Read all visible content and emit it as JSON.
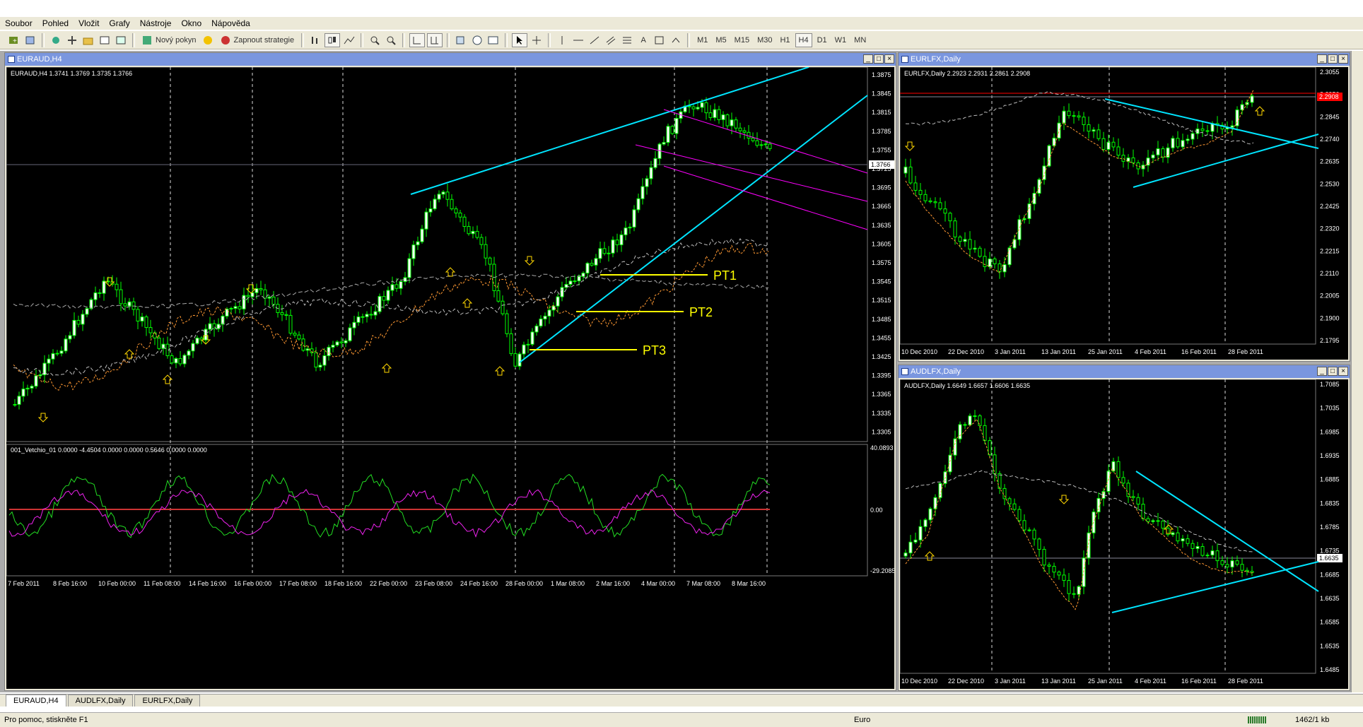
{
  "menu": [
    "Soubor",
    "Pohled",
    "Vložit",
    "Grafy",
    "Nástroje",
    "Okno",
    "Nápověda"
  ],
  "toolbar": {
    "new_order": "Nový pokyn",
    "start_strategy": "Zapnout strategie",
    "text_tool": "A",
    "timeframes": [
      "M1",
      "M5",
      "M15",
      "M30",
      "H1",
      "H4",
      "D1",
      "W1",
      "MN"
    ],
    "active_timeframe": "H4"
  },
  "windows": {
    "euraud": {
      "title": "EURAUD,H4",
      "info": "EURAUD,H4  1.3741 1.3769 1.3735 1.3766",
      "price_labels": [
        "1.3875",
        "1.3845",
        "1.3815",
        "1.3785",
        "1.3755",
        "1.3725",
        "1.3695",
        "1.3665",
        "1.3635",
        "1.3605",
        "1.3575",
        "1.3545",
        "1.3515",
        "1.3485",
        "1.3455",
        "1.3425",
        "1.3395",
        "1.3365",
        "1.3335",
        "1.3305"
      ],
      "current_price": "1.3766",
      "indicator_info": "001_Vetchio_01 0.0000 -4.4504 0.0000 0.0000 0.5646 0.0000 0.0000",
      "indicator_labels": [
        "40.0893",
        "0.00",
        "-29.2085"
      ],
      "date_labels": [
        "7 Feb 2011",
        "8 Feb 16:00",
        "10 Feb 00:00",
        "11 Feb 08:00",
        "14 Feb 16:00",
        "16 Feb 00:00",
        "17 Feb 08:00",
        "18 Feb 16:00",
        "22 Feb 00:00",
        "23 Feb 08:00",
        "24 Feb 16:00",
        "28 Feb 00:00",
        "1 Mar 08:00",
        "2 Mar 16:00",
        "4 Mar 00:00",
        "7 Mar 08:00",
        "8 Mar 16:00"
      ],
      "targets": [
        "PT1",
        "PT2",
        "PT3"
      ]
    },
    "eurlfx": {
      "title": "EURLFX,Daily",
      "info": "EURLFX,Daily  2.2923 2.2931 2.2861 2.2908",
      "price_labels": [
        "2.3055",
        "2.2950",
        "2.2845",
        "2.2740",
        "2.2635",
        "2.2530",
        "2.2425",
        "2.2320",
        "2.2215",
        "2.2110",
        "2.2005",
        "2.1900",
        "2.1795"
      ],
      "current_price": "2.2908",
      "date_labels": [
        "10 Dec 2010",
        "22 Dec 2010",
        "3 Jan 2011",
        "13 Jan 2011",
        "25 Jan 2011",
        "4 Feb 2011",
        "16 Feb 2011",
        "28 Feb 2011"
      ]
    },
    "audlfx": {
      "title": "AUDLFX,Daily",
      "info": "AUDLFX,Daily  1.6649 1.6657 1.6606 1.6635",
      "price_labels": [
        "1.7085",
        "1.7035",
        "1.6985",
        "1.6935",
        "1.6885",
        "1.6835",
        "1.6785",
        "1.6735",
        "1.6685",
        "1.6635",
        "1.6585",
        "1.6535",
        "1.6485"
      ],
      "current_price": "1.6635",
      "date_labels": [
        "10 Dec 2010",
        "22 Dec 2010",
        "3 Jan 2011",
        "13 Jan 2011",
        "25 Jan 2011",
        "4 Feb 2011",
        "16 Feb 2011",
        "28 Feb 2011"
      ]
    }
  },
  "tabs": [
    "EURAUD,H4",
    "AUDLFX,Daily",
    "EURLFX,Daily"
  ],
  "active_tab": "EURAUD,H4",
  "status": {
    "help": "Pro pomoc, stiskněte F1",
    "profile": "Euro",
    "traffic": "1462/1 kb"
  },
  "colors": {
    "chart_bg": "#000000",
    "bull_candle": "#00FF00",
    "trend_line": "#00E5FF",
    "channel": "#FF00FF",
    "target_line": "#FFFF00",
    "indicator_green": "#22DD22",
    "indicator_magenta": "#EE22EE",
    "zero_line": "#CC3333",
    "current_price_red": "#FF0000"
  }
}
